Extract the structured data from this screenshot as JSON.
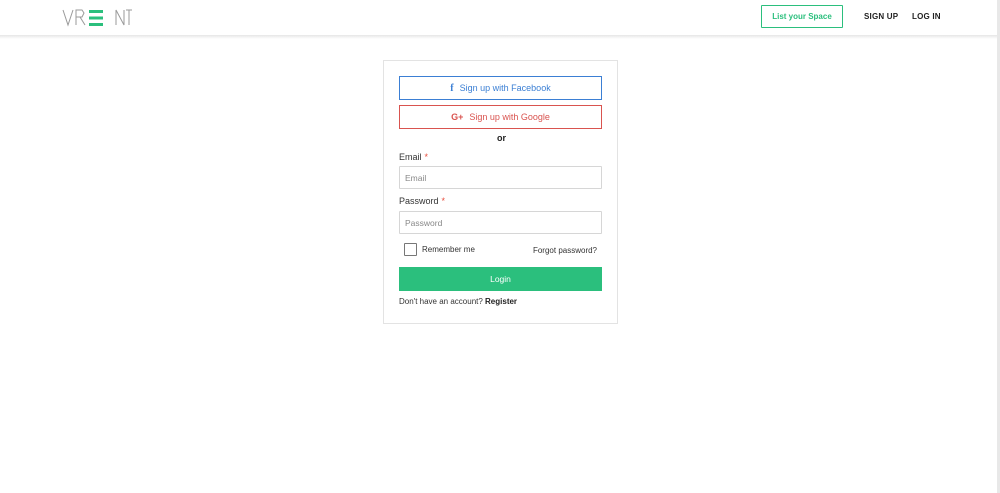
{
  "header": {
    "logo_text": "VRENT",
    "list_space_label": "List your Space",
    "signup_label": "SIGN UP",
    "login_label": "LOG IN"
  },
  "colors": {
    "accent_green": "#2bbf7d",
    "facebook_blue": "#3b7fd4",
    "google_red": "#d9534f"
  },
  "social": {
    "facebook_icon": "facebook-f-icon",
    "facebook_label": "Sign up with Facebook",
    "google_icon": "google-plus-icon",
    "google_label": "Sign up with Google",
    "separator": "or"
  },
  "form": {
    "email_label": "Email",
    "email_required_mark": "*",
    "email_placeholder": "Email",
    "email_value": "",
    "password_label": "Password",
    "password_required_mark": "*",
    "password_placeholder": "Password",
    "password_value": "",
    "remember_label": "Remember me",
    "remember_checked": false,
    "forgot_label": "Forgot password?",
    "login_label": "Login",
    "no_account_text": "Don't have an account? ",
    "register_label": "Register"
  }
}
